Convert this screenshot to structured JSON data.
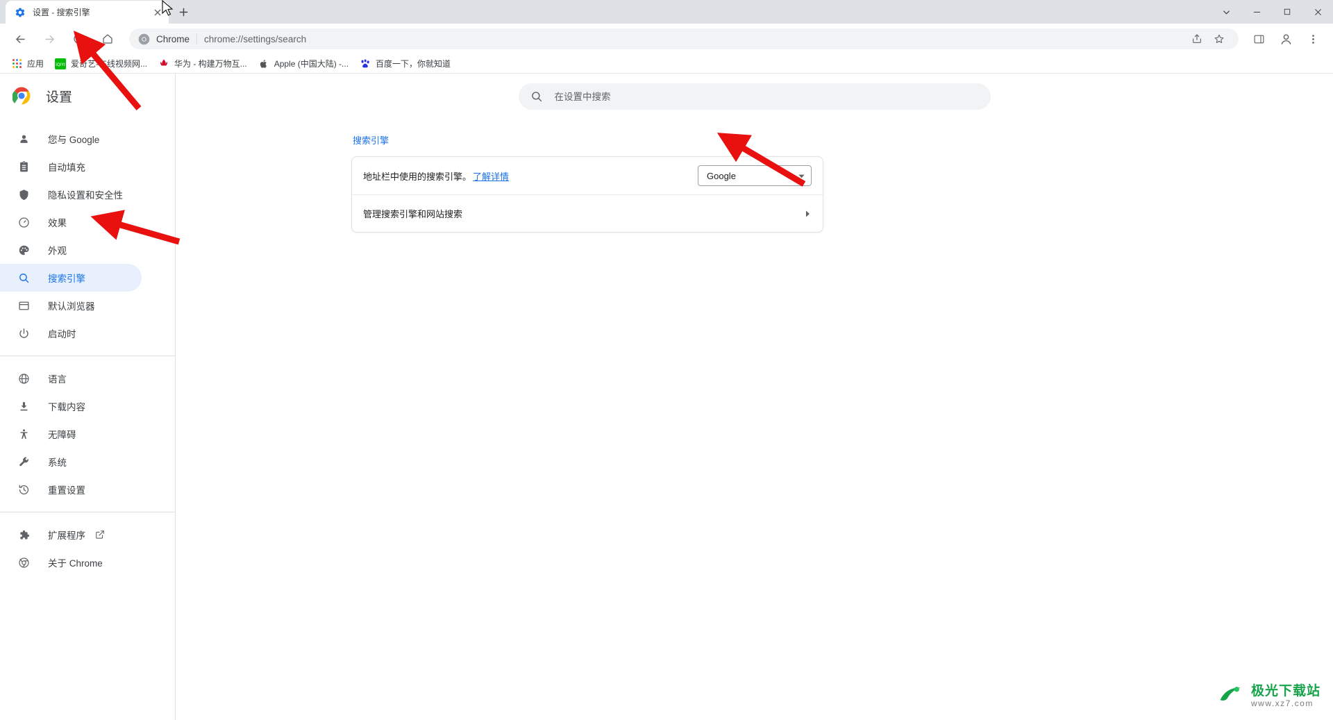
{
  "window": {
    "tab": {
      "title": "设置 - 搜索引擎",
      "favicon": "gear-icon",
      "close_label": "×"
    },
    "new_tab_label": "+",
    "controls": {
      "minimize": "—",
      "maximize": "▢",
      "close": "✕",
      "chevron": "⌄"
    }
  },
  "toolbar": {
    "back": "←",
    "forward": "→",
    "reload": "⟳",
    "home": "⌂",
    "omnibox": {
      "chrome_label": "Chrome",
      "url": "chrome://settings/search",
      "share_icon": "share-icon",
      "bookmark_icon": "star-icon",
      "sidepanel_icon": "side-panel-icon",
      "profile_icon": "profile-icon",
      "menu_icon": "three-dot-menu-icon"
    }
  },
  "bookmarks": [
    {
      "label": "应用",
      "icon": "apps-grid-icon"
    },
    {
      "label": "爱奇艺-在线视频网...",
      "icon": "iqiyi-icon"
    },
    {
      "label": "华为 - 构建万物互...",
      "icon": "huawei-icon"
    },
    {
      "label": "Apple (中国大陆) -...",
      "icon": "apple-icon"
    },
    {
      "label": "百度一下，你就知道",
      "icon": "baidu-icon"
    }
  ],
  "sidebar": {
    "title": "设置",
    "logo": "chrome-logo-icon",
    "groups": [
      {
        "items": [
          {
            "label": "您与 Google",
            "icon": "person-icon",
            "active": false
          },
          {
            "label": "自动填充",
            "icon": "clipboard-icon",
            "active": false
          },
          {
            "label": "隐私设置和安全性",
            "icon": "shield-icon",
            "active": false
          },
          {
            "label": "效果",
            "icon": "speedometer-icon",
            "active": false
          },
          {
            "label": "外观",
            "icon": "palette-icon",
            "active": false
          },
          {
            "label": "搜索引擎",
            "icon": "search-icon",
            "active": true
          },
          {
            "label": "默认浏览器",
            "icon": "browser-window-icon",
            "active": false
          },
          {
            "label": "启动时",
            "icon": "power-icon",
            "active": false
          }
        ]
      },
      {
        "items": [
          {
            "label": "语言",
            "icon": "globe-icon",
            "active": false
          },
          {
            "label": "下载内容",
            "icon": "download-icon",
            "active": false
          },
          {
            "label": "无障碍",
            "icon": "accessibility-icon",
            "active": false
          },
          {
            "label": "系统",
            "icon": "wrench-icon",
            "active": false
          },
          {
            "label": "重置设置",
            "icon": "history-restore-icon",
            "active": false
          }
        ]
      },
      {
        "items": [
          {
            "label": "扩展程序",
            "icon": "puzzle-icon",
            "active": false,
            "external": true
          },
          {
            "label": "关于 Chrome",
            "icon": "chrome-outline-icon",
            "active": false
          }
        ]
      }
    ]
  },
  "main": {
    "search": {
      "placeholder": "在设置中搜索",
      "value": "",
      "icon": "search-icon"
    },
    "section": {
      "title": "搜索引擎",
      "rows": [
        {
          "text": "地址栏中使用的搜索引擎。",
          "link": "了解详情",
          "control": "select",
          "selected": "Google"
        },
        {
          "text": "管理搜索引擎和网站搜索",
          "control": "arrow",
          "arrow": "›"
        }
      ]
    }
  },
  "watermark": {
    "title": "极光下载站",
    "subtitle": "www.xz7.com",
    "icon": "aurora-logo-icon"
  }
}
